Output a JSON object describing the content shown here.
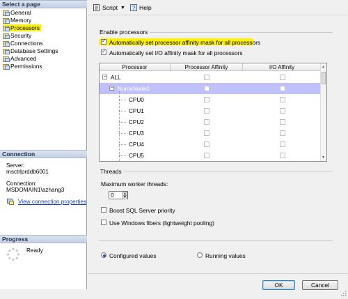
{
  "left": {
    "select_page_header": "Select a page",
    "pages": [
      {
        "label": "General",
        "selected": false
      },
      {
        "label": "Memory",
        "selected": false
      },
      {
        "label": "Processors",
        "selected": true
      },
      {
        "label": "Security",
        "selected": false
      },
      {
        "label": "Connections",
        "selected": false
      },
      {
        "label": "Database Settings",
        "selected": false
      },
      {
        "label": "Advanced",
        "selected": false
      },
      {
        "label": "Permissions",
        "selected": false
      }
    ],
    "connection_header": "Connection",
    "server_label": "Server:",
    "server_value": "msctrlprddb6001",
    "connection_label": "Connection:",
    "connection_value": "MSDOMAIN1\\azhang3",
    "view_connection_link": "View connection properties",
    "progress_header": "Progress",
    "progress_status": "Ready"
  },
  "toolbar": {
    "script_label": "Script",
    "help_label": "Help"
  },
  "enable_processors": {
    "group_title": "Enable processors",
    "auto_processor_affinity": {
      "label": "Automatically set processor affinity mask for all processors",
      "checked": true
    },
    "auto_io_affinity": {
      "label": "Automatically set I/O affinity mask for all processors",
      "checked": true
    }
  },
  "grid": {
    "columns": [
      "Processor",
      "Processor Affinity",
      "I/O Affinity"
    ],
    "rows": [
      {
        "name": "ALL",
        "level": 0,
        "highlighted": false
      },
      {
        "name": "NumaNode0",
        "level": 1,
        "highlighted": true
      },
      {
        "name": "CPU0",
        "level": 2,
        "highlighted": false
      },
      {
        "name": "CPU1",
        "level": 2,
        "highlighted": false
      },
      {
        "name": "CPU2",
        "level": 2,
        "highlighted": false
      },
      {
        "name": "CPU3",
        "level": 2,
        "highlighted": false
      },
      {
        "name": "CPU4",
        "level": 2,
        "highlighted": false
      },
      {
        "name": "CPU5",
        "level": 2,
        "highlighted": false
      }
    ]
  },
  "threads": {
    "group_title": "Threads",
    "max_worker_label": "Maximum worker threads:",
    "max_worker_value": "0",
    "boost_priority": {
      "label": "Boost SQL Server priority",
      "checked": false
    },
    "windows_fibers": {
      "label": "Use Windows fibers (lightweight pooling)",
      "checked": false
    }
  },
  "values_mode": {
    "configured_label": "Configured values",
    "running_label": "Running values",
    "selected": "configured"
  },
  "buttons": {
    "ok_label": "OK",
    "cancel_label": "Cancel"
  },
  "colors": {
    "highlight_yellow": "#fff200",
    "row_highlight": "#c0c0ff",
    "link_blue": "#1540c9"
  }
}
